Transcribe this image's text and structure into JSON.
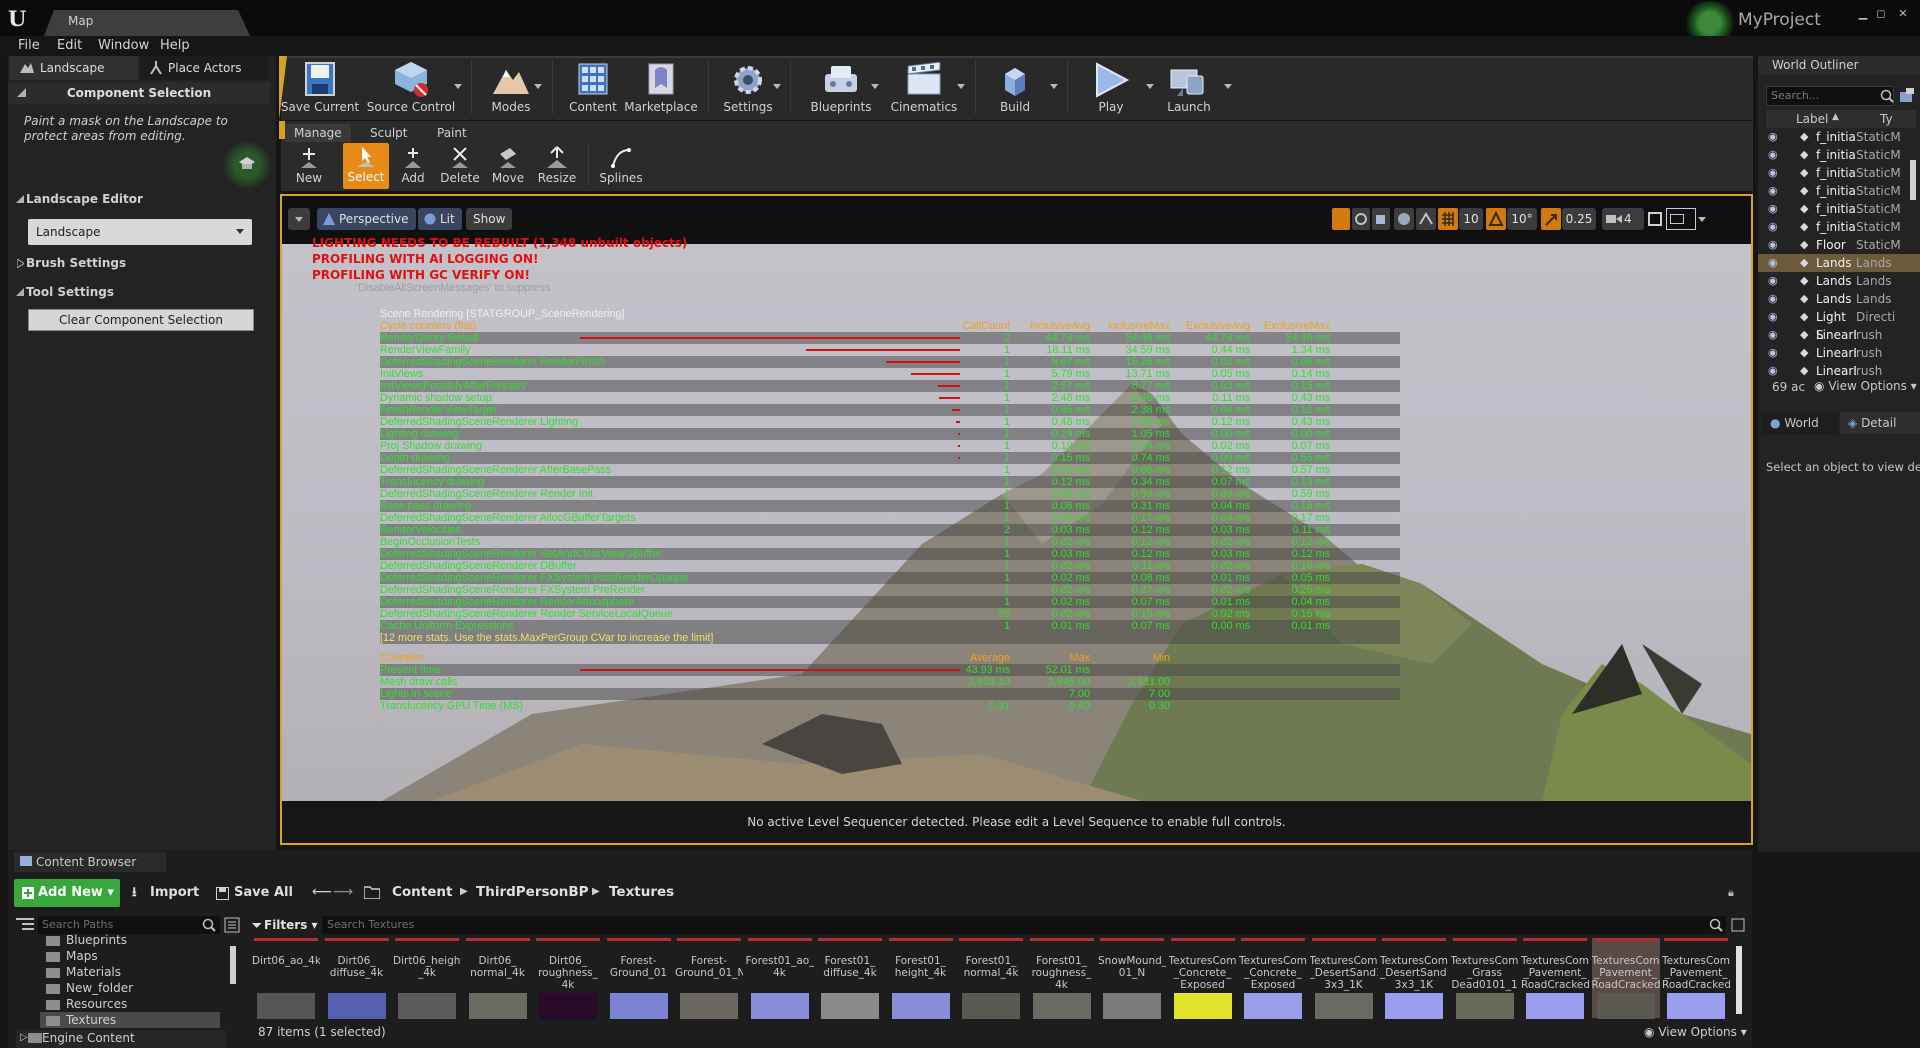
{
  "window": {
    "tab_title": "Map",
    "project_name": "MyProject",
    "controls": [
      "▁",
      "◻",
      "✕"
    ]
  },
  "menu": [
    "File",
    "Edit",
    "Window",
    "Help"
  ],
  "left_panel": {
    "tabs": [
      "Landscape",
      "Place Actors"
    ],
    "component_selection_title": "Component Selection",
    "description": "Paint a mask on the Landscape to protect areas from editing.",
    "landscape_editor_title": "Landscape Editor",
    "landscape_dropdown": "Landscape",
    "brush_settings": "Brush Settings",
    "tool_settings": "Tool Settings",
    "clear_button": "Clear Component Selection"
  },
  "toolbar": [
    {
      "label": "Save Current",
      "icon": "save-icon"
    },
    {
      "label": "Source Control",
      "icon": "source-control-icon"
    },
    {
      "label": "Modes",
      "icon": "modes-icon"
    },
    {
      "label": "Content",
      "icon": "content-icon"
    },
    {
      "label": "Marketplace",
      "icon": "marketplace-icon"
    },
    {
      "label": "Settings",
      "icon": "settings-icon"
    },
    {
      "label": "Blueprints",
      "icon": "blueprints-icon"
    },
    {
      "label": "Cinematics",
      "icon": "cinematics-icon"
    },
    {
      "label": "Build",
      "icon": "build-icon"
    },
    {
      "label": "Play",
      "icon": "play-icon"
    },
    {
      "label": "Launch",
      "icon": "launch-icon"
    }
  ],
  "mode_tabs": [
    "Manage",
    "Sculpt",
    "Paint"
  ],
  "mode_tools": [
    "New",
    "Select",
    "Add",
    "Delete",
    "Move",
    "Resize",
    "Splines"
  ],
  "viewport": {
    "view_mode": "Perspective",
    "lighting": "Lit",
    "show": "Show",
    "grid_snap": "10",
    "rotation_snap": "10°",
    "scale_snap": "0.25",
    "camera_speed": "4",
    "status": "No active Level Sequencer detected. Please edit a Level Sequence to enable full controls.",
    "warnings": [
      "LIGHTING NEEDS TO BE REBUILT (1,348 unbuilt objects)",
      "PROFILING WITH AI LOGGING ON!",
      "PROFILING WITH GC VERIFY ON!"
    ],
    "overlay_hint": "'DisableAllScreenMessages' to suppress"
  },
  "stats": {
    "group_title": "Scene Rendering [STATGROUP_SceneRendering]",
    "cycle_header": "Cycle counters (flat)",
    "cycle_columns": [
      "CallCount",
      "InclusiveAvg",
      "InclusiveMax",
      "ExclusiveAvg",
      "ExclusiveMax"
    ],
    "cycle_rows": [
      {
        "name": "RenderQuery Result",
        "call": "2",
        "inc_avg": "44.74 ms",
        "inc_max": "54.46 ms",
        "exc_avg": "44.74 ms",
        "exc_max": "54.46 ms",
        "bar": 1.0
      },
      {
        "name": "RenderViewFamily",
        "call": "1",
        "inc_avg": "18.11 ms",
        "inc_max": "34.59 ms",
        "exc_avg": "0.44 ms",
        "exc_max": "1.34 ms",
        "bar": 0.405
      },
      {
        "name": "DeferredShadingSceneRenderer RenderFinish",
        "call": "1",
        "inc_avg": "8.67 ms",
        "inc_max": "16.26 ms",
        "exc_avg": "0.02 ms",
        "exc_max": "0.06 ms",
        "bar": 0.194
      },
      {
        "name": "InitViews",
        "call": "1",
        "inc_avg": "5.79 ms",
        "inc_max": "13.71 ms",
        "exc_avg": "0.05 ms",
        "exc_max": "0.14 ms",
        "bar": 0.129
      },
      {
        "name": "InitViewsPossiblyAfterPrepass",
        "call": "1",
        "inc_avg": "2.57 ms",
        "inc_max": "8.77 ms",
        "exc_avg": "0.03 ms",
        "exc_max": "0.15 ms",
        "bar": 0.057
      },
      {
        "name": "Dynamic shadow setup",
        "call": "1",
        "inc_avg": "2.48 ms",
        "inc_max": "8.48 ms",
        "exc_avg": "0.11 ms",
        "exc_max": "0.43 ms",
        "bar": 0.055
      },
      {
        "name": "FinishRenderViewTarget",
        "call": "1",
        "inc_avg": "0.95 ms",
        "inc_max": "2.38 ms",
        "exc_avg": "0.04 ms",
        "exc_max": "0.12 ms",
        "bar": 0.021
      },
      {
        "name": "DeferredShadingSceneRenderer Lighting",
        "call": "1",
        "inc_avg": "0.48 ms",
        "inc_max": "1.55 ms",
        "exc_avg": "0.12 ms",
        "exc_max": "0.43 ms",
        "bar": 0.011
      },
      {
        "name": "Lighting drawing",
        "call": "1",
        "inc_avg": "0.29 ms",
        "inc_max": "1.05 ms",
        "exc_avg": "0.00 ms",
        "exc_max": "0.00 ms",
        "bar": 0.006
      },
      {
        "name": "Proj Shadow drawing",
        "call": "1",
        "inc_avg": "0.19 ms",
        "inc_max": "0.84 ms",
        "exc_avg": "0.02 ms",
        "exc_max": "0.07 ms",
        "bar": 0.004
      },
      {
        "name": "Depth drawing",
        "call": "1",
        "inc_avg": "0.15 ms",
        "inc_max": "0.74 ms",
        "exc_avg": "0.09 ms",
        "exc_max": "0.55 ms",
        "bar": 0.003
      },
      {
        "name": "DeferredShadingSceneRenderer AfterBasePass",
        "call": "1",
        "inc_avg": "0.13 ms",
        "inc_max": "0.68 ms",
        "exc_avg": "0.12 ms",
        "exc_max": "0.57 ms",
        "bar": 0
      },
      {
        "name": "Translucency drawing",
        "call": "1",
        "inc_avg": "0.12 ms",
        "inc_max": "0.34 ms",
        "exc_avg": "0.07 ms",
        "exc_max": "0.19 ms",
        "bar": 0
      },
      {
        "name": "DeferredShadingSceneRenderer Render Init",
        "call": "1",
        "inc_avg": "0.09 ms",
        "inc_max": "0.59 ms",
        "exc_avg": "0.09 ms",
        "exc_max": "0.59 ms",
        "bar": 0
      },
      {
        "name": "Base pass drawing",
        "call": "1",
        "inc_avg": "0.06 ms",
        "inc_max": "0.31 ms",
        "exc_avg": "0.04 ms",
        "exc_max": "0.16 ms",
        "bar": 0
      },
      {
        "name": "DeferredShadingSceneRenderer AllocGBufferTargets",
        "call": "1",
        "inc_avg": "0.04 ms",
        "inc_max": "0.17 ms",
        "exc_avg": "0.04 ms",
        "exc_max": "0.17 ms",
        "bar": 0
      },
      {
        "name": "RenderVelocities",
        "call": "2",
        "inc_avg": "0.03 ms",
        "inc_max": "0.12 ms",
        "exc_avg": "0.03 ms",
        "exc_max": "0.11 ms",
        "bar": 0
      },
      {
        "name": "BeginOcclusionTests",
        "call": "1",
        "inc_avg": "0.02 ms",
        "inc_max": "0.12 ms",
        "exc_avg": "0.02 ms",
        "exc_max": "0.12 ms",
        "bar": 0
      },
      {
        "name": "DeferredShadingSceneRenderer SetAndClearViewGBuffer",
        "call": "1",
        "inc_avg": "0.03 ms",
        "inc_max": "0.12 ms",
        "exc_avg": "0.03 ms",
        "exc_max": "0.12 ms",
        "bar": 0
      },
      {
        "name": "DeferredShadingSceneRenderer DBuffer",
        "call": "1",
        "inc_avg": "0.02 ms",
        "inc_max": "0.11 ms",
        "exc_avg": "0.02 ms",
        "exc_max": "0.10 ms",
        "bar": 0
      },
      {
        "name": "DeferredShadingSceneRenderer FXSystem PostRenderOpaque",
        "call": "1",
        "inc_avg": "0.02 ms",
        "inc_max": "0.08 ms",
        "exc_avg": "0.01 ms",
        "exc_max": "0.05 ms",
        "bar": 0
      },
      {
        "name": "DeferredShadingSceneRenderer FXSystem PreRender",
        "call": "1",
        "inc_avg": "0.02 ms",
        "inc_max": "0.27 ms",
        "exc_avg": "0.02 ms",
        "exc_max": "0.25 ms",
        "bar": 0
      },
      {
        "name": "DeferredShadingSceneRenderer RenderAtmosphere",
        "call": "1",
        "inc_avg": "0.02 ms",
        "inc_max": "0.07 ms",
        "exc_avg": "0.01 ms",
        "exc_max": "0.04 ms",
        "bar": 0
      },
      {
        "name": "DeferredShadingSceneRenderer Render ServiceLocalQueue",
        "call": "26",
        "inc_avg": "0.02 ms",
        "inc_max": "0.15 ms",
        "exc_avg": "0.02 ms",
        "exc_max": "0.15 ms",
        "bar": 0
      },
      {
        "name": "Cache Uniform Expressions",
        "call": "1",
        "inc_avg": "0.01 ms",
        "inc_max": "0.07 ms",
        "exc_avg": "0.00 ms",
        "exc_max": "0.01 ms",
        "bar": 0
      }
    ],
    "more_note": "[12 more stats. Use the stats.MaxPerGroup CVar to increase the limit]",
    "counter_header": "Counters",
    "counter_columns": [
      "Average",
      "Max",
      "Min"
    ],
    "counter_rows": [
      {
        "name": "Present time",
        "avg": "43.93 ms",
        "max": "52.01 ms",
        "min": "",
        "bar": 1.0
      },
      {
        "name": "Mesh draw calls",
        "avg": "2,933.10",
        "max": "2,945.00",
        "min": "2,931.00",
        "bar": 0
      },
      {
        "name": "Lights in scene",
        "avg": "",
        "max": "7.00",
        "min": "7.00",
        "bar": 0
      },
      {
        "name": "Translucency GPU Time (MS)",
        "avg": "0.31",
        "max": "0.40",
        "min": "0.30",
        "bar": 0
      }
    ]
  },
  "world_outliner": {
    "title": "World Outliner",
    "search_placeholder": "Search...",
    "col_label": "Label",
    "col_type": "Ty",
    "rows": [
      {
        "name": "f_initia",
        "type": "StaticM",
        "selected": false
      },
      {
        "name": "f_initia",
        "type": "StaticM",
        "selected": false
      },
      {
        "name": "f_initia",
        "type": "StaticM",
        "selected": false
      },
      {
        "name": "f_initia",
        "type": "StaticM",
        "selected": false
      },
      {
        "name": "f_initia",
        "type": "StaticM",
        "selected": false
      },
      {
        "name": "f_initia",
        "type": "StaticM",
        "selected": false
      },
      {
        "name": "Floor",
        "type": "StaticM",
        "selected": false
      },
      {
        "name": "Lands",
        "type": "Lands",
        "selected": true
      },
      {
        "name": "Lands",
        "type": "Lands",
        "selected": false
      },
      {
        "name": "Lands",
        "type": "Lands",
        "selected": false
      },
      {
        "name": "Light S",
        "type": "Directi",
        "selected": false
      },
      {
        "name": "LinearB",
        "type": "rush",
        "selected": false
      },
      {
        "name": "LinearB",
        "type": "rush",
        "selected": false
      },
      {
        "name": "LinearB",
        "type": "rush",
        "selected": false
      }
    ],
    "actor_count": "69 ac",
    "view_options": "View Options",
    "details_tabs": [
      "World",
      "Detail"
    ],
    "details_empty": "Select an object to view detai"
  },
  "content_browser": {
    "tab": "Content Browser",
    "add_new": "Add New",
    "import": "Import",
    "save_all": "Save All",
    "breadcrumb": [
      "Content",
      "ThirdPersonBP",
      "Textures"
    ],
    "search_paths_placeholder": "Search Paths",
    "filters": "Filters",
    "search_textures_placeholder": "Search Textures",
    "folders": [
      "Blueprints",
      "Maps",
      "Materials",
      "New_folder",
      "Resources",
      "Textures"
    ],
    "engine_content": "Engine Content",
    "item_count": "87 items (1 selected)",
    "view_options": "View Options",
    "assets": [
      {
        "label": "Dirt06_ao_4k",
        "color": "#555555"
      },
      {
        "label": "Dirt06_\ndiffuse_4k",
        "color": "#5560b0"
      },
      {
        "label": "Dirt06_height\n_4k",
        "color": "#5a5a5a"
      },
      {
        "label": "Dirt06_\nnormal_4k",
        "color": "#6a6a60"
      },
      {
        "label": "Dirt06_\nroughness_\n4k",
        "color": "#2a0a2a"
      },
      {
        "label": "Forest-\nGround_01",
        "color": "#7a82d2"
      },
      {
        "label": "Forest-\nGround_01_N",
        "color": "#6a6860"
      },
      {
        "label": "Forest01_ao_\n4k",
        "color": "#8a8ed8"
      },
      {
        "label": "Forest01_\ndiffuse_4k",
        "color": "#8a8a8a"
      },
      {
        "label": "Forest01_\nheight_4k",
        "color": "#8a8ed8"
      },
      {
        "label": "Forest01_\nnormal_4k",
        "color": "#5a5a52"
      },
      {
        "label": "Forest01_\nroughness_\n4k",
        "color": "#6a6a62"
      },
      {
        "label": "SnowMound_\n01_N",
        "color": "#7a7a7a"
      },
      {
        "label": "TexturesCom\n_Concrete_\nExposed",
        "color": "#e2e22a"
      },
      {
        "label": "TexturesCom\n_Concrete_\nExposed",
        "color": "#9a9ee8"
      },
      {
        "label": "TexturesCom\n_DesertSand1\n3x3_1K",
        "color": "#6a6a62"
      },
      {
        "label": "TexturesCom\n_DesertSand1\n3x3_1K",
        "color": "#9a9ef0"
      },
      {
        "label": "TexturesCom\n_Grass\nDead0101_1",
        "color": "#6a6a5a"
      },
      {
        "label": "TexturesCom\n_Pavement_\nRoadCracked",
        "color": "#9a9ef0"
      },
      {
        "label": "TexturesCom\n_Pavement_\nRoadCracked",
        "color": "#5a5a52"
      },
      {
        "label": "TexturesCom\n_Pavement_\nRoadCracked",
        "color": "#9a9ef0"
      }
    ]
  },
  "colors": {
    "accent_orange": "#d7a22a",
    "select_orange": "#e88a18",
    "stats_green": "#33dd33",
    "stats_header": "#f0a020",
    "warning_red": "#e21010"
  }
}
